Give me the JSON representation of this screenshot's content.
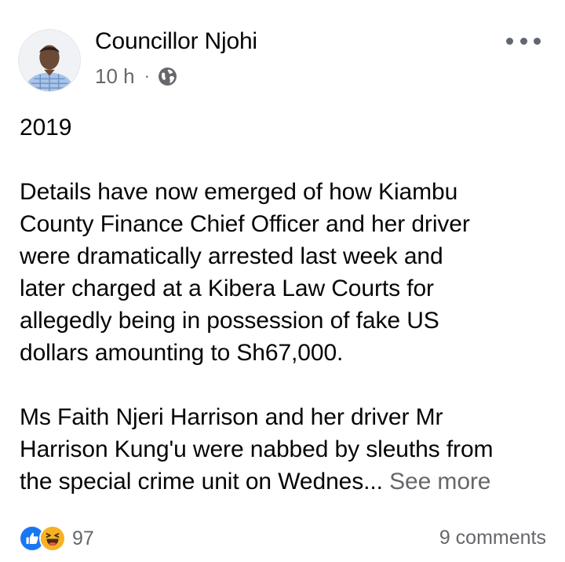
{
  "post": {
    "author": "Councillor Njohi",
    "time": "10 h",
    "separator": "·",
    "privacy_icon": "globe-icon",
    "menu_icon": "more-options-icon",
    "lines": [
      "2019",
      "",
      "Details have now emerged of how Kiambu",
      "County Finance Chief Officer and her driver",
      "were dramatically arrested last week and",
      "later charged at a Kibera Law Courts for",
      "allegedly being in possession of fake US",
      "dollars amounting to Sh67,000.",
      "",
      "Ms Faith Njeri Harrison and her driver Mr",
      "Harrison Kung'u were nabbed by sleuths from"
    ],
    "last_line": "the special crime unit on Wednes...",
    "see_more": "See more"
  },
  "footer": {
    "reaction_icons": [
      "like-icon",
      "haha-icon"
    ],
    "reaction_count": "97",
    "comments": "9 comments"
  },
  "colors": {
    "text": "#050505",
    "secondary": "#65676b",
    "like_blue": "#1877f2",
    "haha_yellow": "#f7b125"
  }
}
